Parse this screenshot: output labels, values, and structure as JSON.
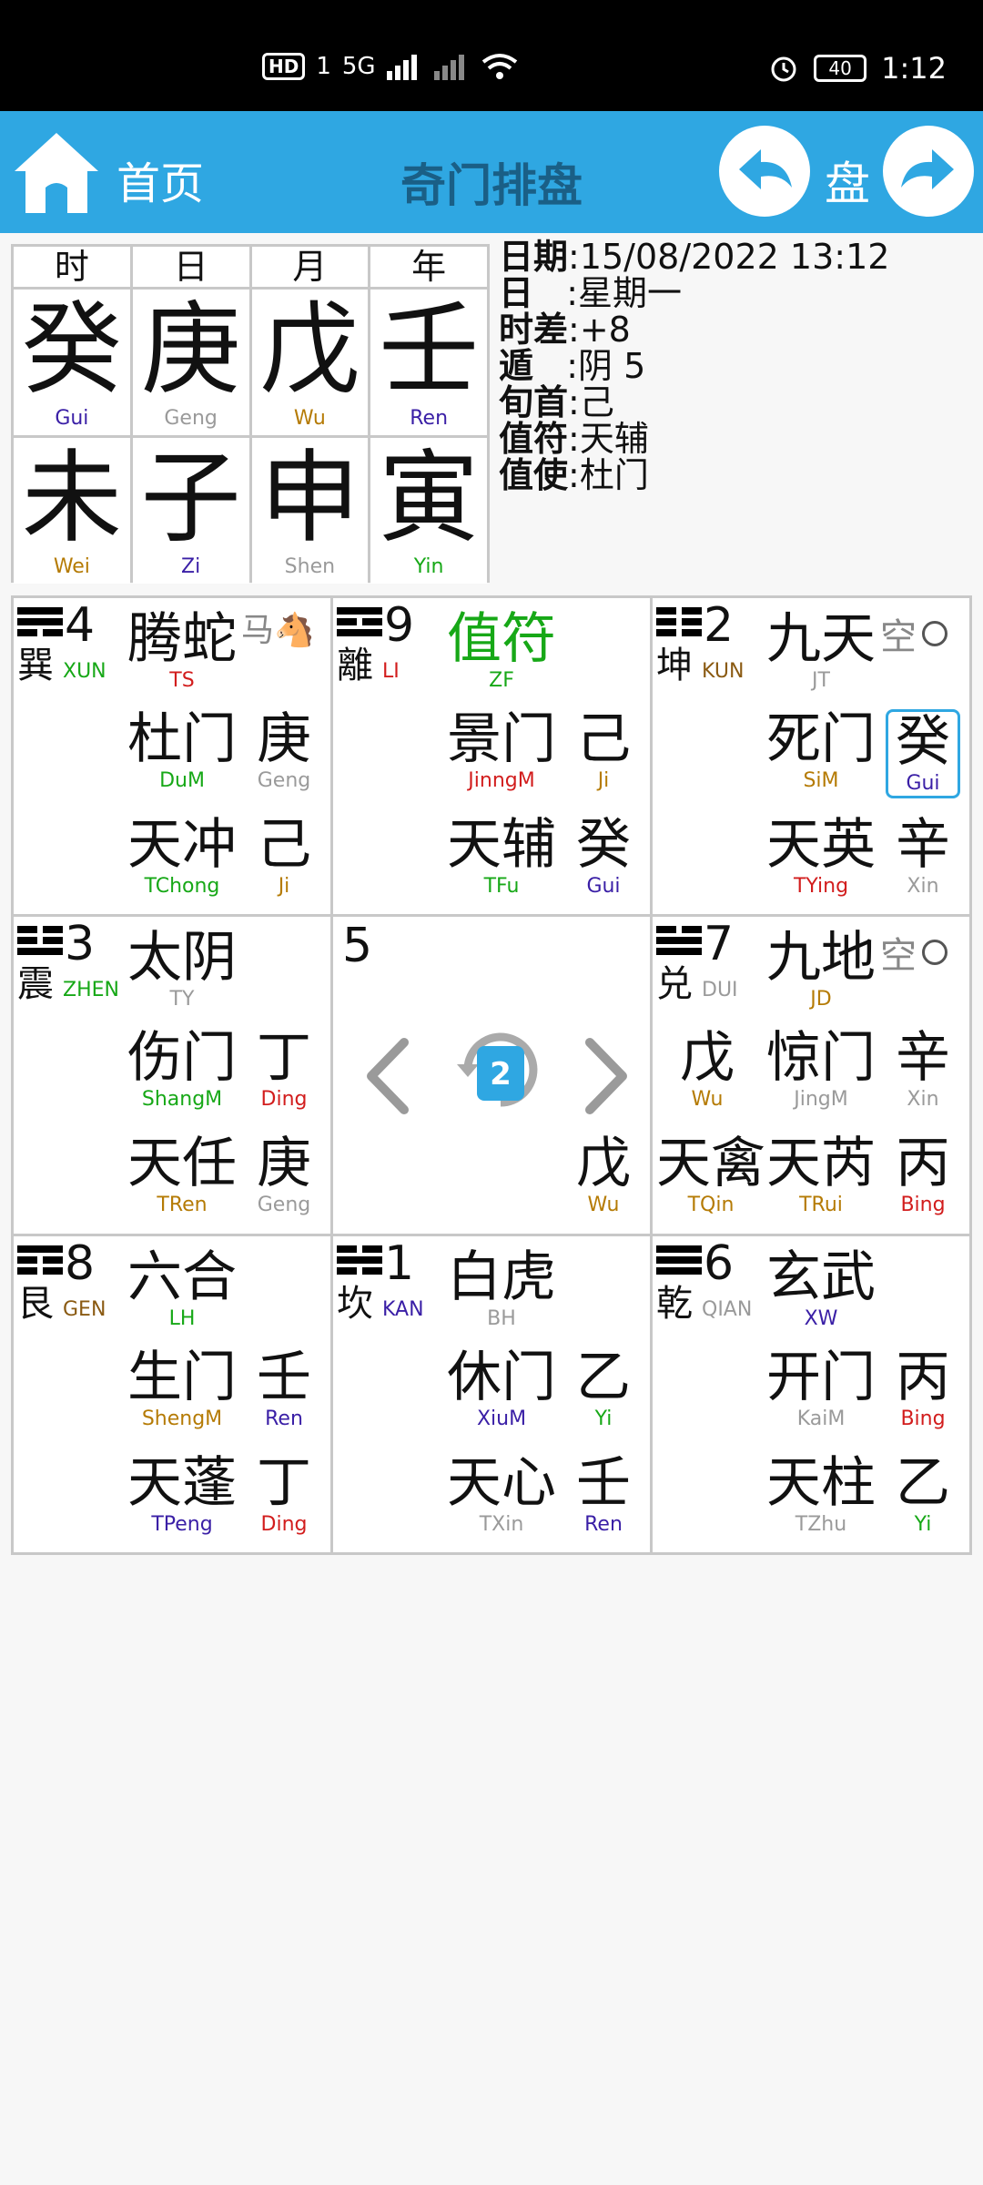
{
  "status": {
    "hd": "HD",
    "sim": "1",
    "net": "5G",
    "battery": "40",
    "time": "1:12"
  },
  "header": {
    "home_label": "首页",
    "title": "奇门排盘",
    "pan_label": "盘"
  },
  "pillars": {
    "heads": [
      "时",
      "日",
      "月",
      "年"
    ],
    "stems": [
      {
        "c": "癸",
        "p": "Gui",
        "color": "#3a1fa6"
      },
      {
        "c": "庚",
        "p": "Geng",
        "color": "#9a9a9a"
      },
      {
        "c": "戊",
        "p": "Wu",
        "color": "#b57b05"
      },
      {
        "c": "壬",
        "p": "Ren",
        "color": "#3a1fa6"
      }
    ],
    "branches": [
      {
        "c": "未",
        "p": "Wei",
        "color": "#b57b05"
      },
      {
        "c": "子",
        "p": "Zi",
        "color": "#3a1fa6"
      },
      {
        "c": "申",
        "p": "Shen",
        "color": "#9a9a9a"
      },
      {
        "c": "寅",
        "p": "Yin",
        "color": "#17a817"
      }
    ]
  },
  "info": [
    {
      "k": "日期",
      "v": ":15/08/2022 13:12"
    },
    {
      "k": "日",
      "v": "   :星期一"
    },
    {
      "k": "时差",
      "v": ":+8"
    },
    {
      "k": "遁",
      "v": "   :阴 5"
    },
    {
      "k": "旬首",
      "v": ":己"
    },
    {
      "k": "值符",
      "v": ":天辅"
    },
    {
      "k": "值使",
      "v": ":杜门"
    }
  ],
  "palaces": {
    "xun": {
      "num": "4",
      "gua": "巽",
      "gua_pin": "XUN",
      "god": "腾蛇",
      "god_pin": "TS",
      "horse": "马🐴",
      "door": "杜门",
      "door_pin": "DuM",
      "heav": "庚",
      "heav_pin": "Geng",
      "star": "天冲",
      "star_pin": "TChong",
      "earth": "己",
      "earth_pin": "Ji"
    },
    "li": {
      "num": "9",
      "gua": "離",
      "gua_pin": "LI",
      "god": "值符",
      "god_pin": "ZF",
      "door": "景门",
      "door_pin": "JinngM",
      "heav": "己",
      "heav_pin": "Ji",
      "star": "天辅",
      "star_pin": "TFu",
      "earth": "癸",
      "earth_pin": "Gui"
    },
    "kun": {
      "num": "2",
      "gua": "坤",
      "gua_pin": "KUN",
      "god": "九天",
      "god_pin": "JT",
      "kong": "空",
      "door": "死门",
      "door_pin": "SiM",
      "heav": "癸",
      "heav_pin": "Gui",
      "star": "天英",
      "star_pin": "TYing",
      "earth": "辛",
      "earth_pin": "Xin"
    },
    "zhen": {
      "num": "3",
      "gua": "震",
      "gua_pin": "ZHEN",
      "god": "太阴",
      "god_pin": "TY",
      "door": "伤门",
      "door_pin": "ShangM",
      "heav": "丁",
      "heav_pin": "Ding",
      "star": "天任",
      "star_pin": "TRen",
      "earth": "庚",
      "earth_pin": "Geng"
    },
    "center": {
      "num": "5",
      "earth": "戊",
      "earth_pin": "Wu",
      "page": "2"
    },
    "dui": {
      "num": "7",
      "gua": "兑",
      "gua_pin": "DUI",
      "god": "九地",
      "god_pin": "JD",
      "kong": "空",
      "door": "惊门",
      "door_pin": "JingM",
      "heav": "辛",
      "heav_pin": "Xin",
      "extra_heav": "戊",
      "extra_heav_pin": "Wu",
      "star": "天芮",
      "star_pin": "TRui",
      "extra_star": "天禽",
      "extra_star_pin": "TQin",
      "earth": "丙",
      "earth_pin": "Bing"
    },
    "gen": {
      "num": "8",
      "gua": "艮",
      "gua_pin": "GEN",
      "god": "六合",
      "god_pin": "LH",
      "door": "生门",
      "door_pin": "ShengM",
      "heav": "壬",
      "heav_pin": "Ren",
      "star": "天蓬",
      "star_pin": "TPeng",
      "earth": "丁",
      "earth_pin": "Ding"
    },
    "kan": {
      "num": "1",
      "gua": "坎",
      "gua_pin": "KAN",
      "god": "白虎",
      "god_pin": "BH",
      "door": "休门",
      "door_pin": "XiuM",
      "heav": "乙",
      "heav_pin": "Yi",
      "star": "天心",
      "star_pin": "TXin",
      "earth": "壬",
      "earth_pin": "Ren"
    },
    "qian": {
      "num": "6",
      "gua": "乾",
      "gua_pin": "QIAN",
      "god": "玄武",
      "god_pin": "XW",
      "door": "开门",
      "door_pin": "KaiM",
      "heav": "丙",
      "heav_pin": "Bing",
      "star": "天柱",
      "star_pin": "TZhu",
      "earth": "乙",
      "earth_pin": "Yi"
    }
  }
}
